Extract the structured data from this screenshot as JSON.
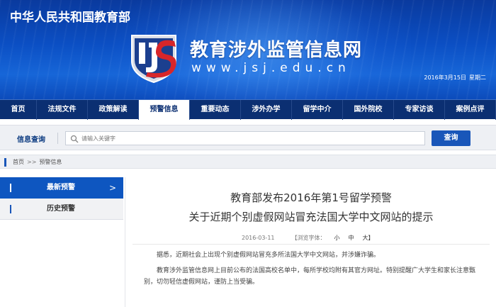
{
  "header": {
    "ministry": "中华人民共和国教育部",
    "site_title": "教育涉外监管信息网",
    "site_url": "www.jsj.edu.cn",
    "date": "2016年3月15日",
    "weekday": "星期二"
  },
  "nav": {
    "items": [
      {
        "label": "首页"
      },
      {
        "label": "法规文件"
      },
      {
        "label": "政策解读"
      },
      {
        "label": "预警信息"
      },
      {
        "label": "重要动态"
      },
      {
        "label": "涉外办学"
      },
      {
        "label": "留学中介"
      },
      {
        "label": "国外院校"
      },
      {
        "label": "专家访谈"
      },
      {
        "label": "案例点评"
      }
    ],
    "active_index": 3
  },
  "search": {
    "label": "信息查询",
    "placeholder": "请输入关键字",
    "button": "查询"
  },
  "breadcrumb": {
    "home": "首页",
    "separator": ">>",
    "current": "预警信息"
  },
  "sidebar": {
    "items": [
      {
        "label": "最新预警",
        "chevron": ">"
      },
      {
        "label": "历史预警"
      }
    ]
  },
  "article": {
    "title_line1": "教育部发布2016年第1号留学预警",
    "title_line2": "关于近期个别虚假网站冒充法国大学中文网站的提示",
    "date": "2016-03-11",
    "font_size_label": "【浏览字体：",
    "font_small": "小",
    "font_medium": "中",
    "font_large": "大】",
    "paragraph1": "据悉，近期社会上出现个别虚假网站冒充多所法国大学中文网站，并涉嫌诈骗。",
    "paragraph2": "教育涉外监管信息网上目前公布的法国高校名单中，每所学校均附有其官方网址。特别提醒广大学生和家长注意甄别，切勿轻信虚假网站，谨防上当受骗。"
  },
  "colors": {
    "nav_bg": "#0b2f72",
    "accent": "#1956b9",
    "sidebar_active": "#0e56c0"
  }
}
